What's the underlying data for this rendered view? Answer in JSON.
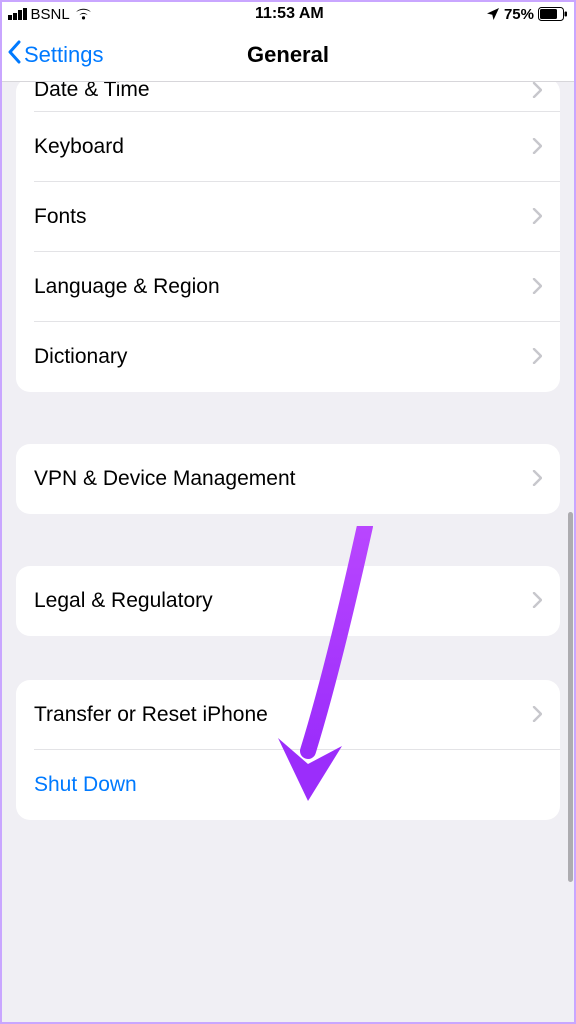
{
  "status": {
    "carrier": "BSNL",
    "time": "11:53 AM",
    "battery_pct": "75%"
  },
  "nav": {
    "back_label": "Settings",
    "title": "General"
  },
  "groups": [
    {
      "rows": [
        {
          "label": "Date & Time",
          "chevron": true,
          "partial_top": true
        },
        {
          "label": "Keyboard",
          "chevron": true
        },
        {
          "label": "Fonts",
          "chevron": true
        },
        {
          "label": "Language & Region",
          "chevron": true
        },
        {
          "label": "Dictionary",
          "chevron": true
        }
      ]
    },
    {
      "rows": [
        {
          "label": "VPN & Device Management",
          "chevron": true
        }
      ]
    },
    {
      "rows": [
        {
          "label": "Legal & Regulatory",
          "chevron": true
        }
      ]
    },
    {
      "rows": [
        {
          "label": "Transfer or Reset iPhone",
          "chevron": true
        },
        {
          "label": "Shut Down",
          "link": true
        }
      ]
    }
  ]
}
